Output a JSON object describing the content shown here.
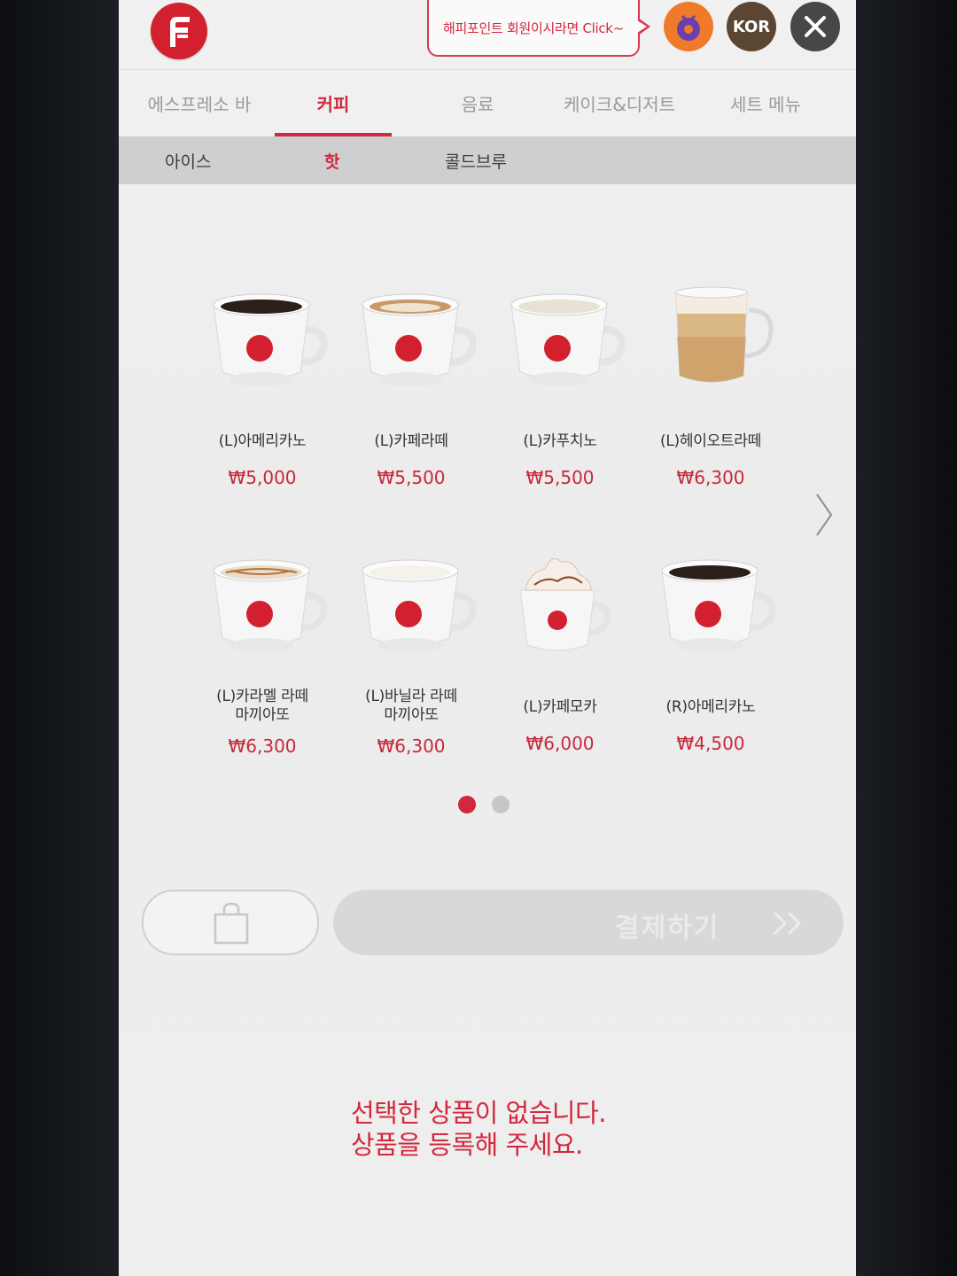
{
  "header": {
    "promo_text": "해피포인트 회원이시라면 Click~",
    "language_label": "KOR"
  },
  "tabs": [
    {
      "label": "에스프레소 바",
      "active": false
    },
    {
      "label": "커피",
      "active": true
    },
    {
      "label": "음료",
      "active": false
    },
    {
      "label": "케이크&디저트",
      "active": false
    },
    {
      "label": "세트 메뉴",
      "active": false
    }
  ],
  "subtabs": [
    {
      "label": "아이스",
      "active": false
    },
    {
      "label": "핫",
      "active": true
    },
    {
      "label": "콜드브루",
      "active": false
    }
  ],
  "products": [
    {
      "name": "(L)아메리카노",
      "price": "₩5,000",
      "icon": "americano-cup-icon"
    },
    {
      "name": "(L)카페라떼",
      "price": "₩5,500",
      "icon": "latte-cup-icon"
    },
    {
      "name": "(L)카푸치노",
      "price": "₩5,500",
      "icon": "cappuccino-cup-icon"
    },
    {
      "name": "(L)헤이오트라떼",
      "price": "₩6,300",
      "icon": "oat-latte-glass-icon"
    },
    {
      "name": "(L)카라멜 라떼\n마끼아또",
      "price": "₩6,300",
      "icon": "caramel-macchiato-cup-icon"
    },
    {
      "name": "(L)바닐라 라떼\n마끼아또",
      "price": "₩6,300",
      "icon": "vanilla-macchiato-cup-icon"
    },
    {
      "name": "(L)카페모카",
      "price": "₩6,000",
      "icon": "cafe-mocha-cup-icon"
    },
    {
      "name": "(R)아메리카노",
      "price": "₩4,500",
      "icon": "americano-cup-icon"
    }
  ],
  "pagination": {
    "current": 1,
    "total": 2
  },
  "footer": {
    "pay_label": "결제하기",
    "empty_line1": "선택한 상품이 없습니다.",
    "empty_line2": "상품을 등록해 주세요."
  },
  "colors": {
    "accent": "#d2283e",
    "happy_point": "#ef7a2a",
    "lang": "#5b4533",
    "close": "#474747"
  }
}
